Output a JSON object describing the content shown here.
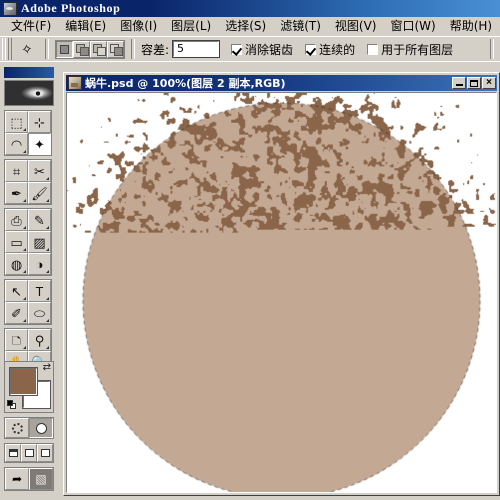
{
  "app": {
    "title": "Adobe Photoshop",
    "icon": "photoshop-app-icon"
  },
  "menubar": {
    "items": [
      {
        "label": "文件(F)",
        "name": "menu-file"
      },
      {
        "label": "编辑(E)",
        "name": "menu-edit"
      },
      {
        "label": "图像(I)",
        "name": "menu-image"
      },
      {
        "label": "图层(L)",
        "name": "menu-layer"
      },
      {
        "label": "选择(S)",
        "name": "menu-select"
      },
      {
        "label": "滤镜(T)",
        "name": "menu-filter"
      },
      {
        "label": "视图(V)",
        "name": "menu-view"
      },
      {
        "label": "窗口(W)",
        "name": "menu-window"
      },
      {
        "label": "帮助(H)",
        "name": "menu-help"
      }
    ]
  },
  "options_bar": {
    "active_tool_icon": "magic-wand-icon",
    "selection_modes": [
      {
        "name": "new-selection",
        "active": true
      },
      {
        "name": "add-to-selection",
        "active": false
      },
      {
        "name": "subtract-from-selection",
        "active": false
      },
      {
        "name": "intersect-selection",
        "active": false
      }
    ],
    "tolerance_label": "容差:",
    "tolerance_value": "5",
    "checkboxes": [
      {
        "label": "消除锯齿",
        "checked": true,
        "name": "anti-alias-checkbox"
      },
      {
        "label": "连续的",
        "checked": true,
        "name": "contiguous-checkbox"
      },
      {
        "label": "用于所有图层",
        "checked": false,
        "name": "all-layers-checkbox"
      }
    ]
  },
  "toolbox": {
    "tools": [
      [
        {
          "glyph": "⬚",
          "name": "marquee-tool",
          "selected": false,
          "arrow": true
        },
        {
          "glyph": "⊹",
          "name": "move-tool",
          "selected": false,
          "arrow": false
        }
      ],
      [
        {
          "glyph": "◠",
          "name": "lasso-tool",
          "selected": false,
          "arrow": true
        },
        {
          "glyph": "✦",
          "name": "magic-wand-tool",
          "selected": true,
          "arrow": false
        }
      ],
      [
        {
          "glyph": "⌗",
          "name": "crop-tool",
          "selected": false,
          "arrow": false
        },
        {
          "glyph": "✂",
          "name": "slice-tool",
          "selected": false,
          "arrow": true
        }
      ],
      [
        {
          "glyph": "✒",
          "name": "healing-brush-tool",
          "selected": false,
          "arrow": true
        },
        {
          "glyph": "🖌",
          "name": "paintbrush-tool",
          "selected": false,
          "arrow": true
        }
      ],
      [
        {
          "glyph": "⎙",
          "name": "clone-stamp-tool",
          "selected": false,
          "arrow": true
        },
        {
          "glyph": "✎",
          "name": "history-brush-tool",
          "selected": false,
          "arrow": true
        }
      ],
      [
        {
          "glyph": "▭",
          "name": "eraser-tool",
          "selected": false,
          "arrow": true
        },
        {
          "glyph": "▨",
          "name": "gradient-tool",
          "selected": false,
          "arrow": true
        }
      ],
      [
        {
          "glyph": "◍",
          "name": "blur-tool",
          "selected": false,
          "arrow": true
        },
        {
          "glyph": "◑",
          "name": "dodge-tool",
          "selected": false,
          "arrow": true
        }
      ],
      [
        {
          "glyph": "↖",
          "name": "path-selection-tool",
          "selected": false,
          "arrow": true
        },
        {
          "glyph": "T",
          "name": "type-tool",
          "selected": false,
          "arrow": true
        }
      ],
      [
        {
          "glyph": "✐",
          "name": "pen-tool",
          "selected": false,
          "arrow": true
        },
        {
          "glyph": "⬭",
          "name": "shape-tool",
          "selected": false,
          "arrow": true
        }
      ],
      [
        {
          "glyph": "🗅",
          "name": "notes-tool",
          "selected": false,
          "arrow": true
        },
        {
          "glyph": "⚲",
          "name": "eyedropper-tool",
          "selected": false,
          "arrow": true
        }
      ],
      [
        {
          "glyph": "✋",
          "name": "hand-tool",
          "selected": false,
          "arrow": false
        },
        {
          "glyph": "🔍",
          "name": "zoom-tool",
          "selected": false,
          "arrow": false
        }
      ]
    ],
    "colors": {
      "foreground": "#8a6549",
      "background": "#ffffff",
      "swap_icon": "swap-colors-icon",
      "default_icon": "default-colors-icon"
    },
    "quick_mask": [
      {
        "name": "standard-mode-button",
        "active": false
      },
      {
        "name": "quick-mask-mode-button",
        "active": true
      }
    ],
    "screen_modes": [
      {
        "name": "standard-screen-mode-button"
      },
      {
        "name": "full-screen-menubar-mode-button"
      },
      {
        "name": "full-screen-mode-button"
      }
    ],
    "jump_buttons": [
      {
        "name": "jump-to-imageready-button",
        "glyph": "➦"
      },
      {
        "name": "imageready-icon-button",
        "glyph": "▧"
      }
    ]
  },
  "document": {
    "title": "蜗牛.psd @ 100%(图层 2 副本,RGB)",
    "window_buttons": [
      {
        "name": "doc-minimize-button"
      },
      {
        "name": "doc-maximize-button"
      },
      {
        "name": "doc-close-button"
      }
    ],
    "artwork": {
      "name": "mezzotint-noise-artwork",
      "background_color": "#ffffff",
      "speckle_color": "#8a6549",
      "selection_fill_color": "#c3a893",
      "selection_shape": "circle",
      "selection_center_x": 0.5,
      "selection_center_y": 0.52,
      "selection_radius": 0.33,
      "noise_density": 0.42,
      "noise_scale": 7
    }
  }
}
